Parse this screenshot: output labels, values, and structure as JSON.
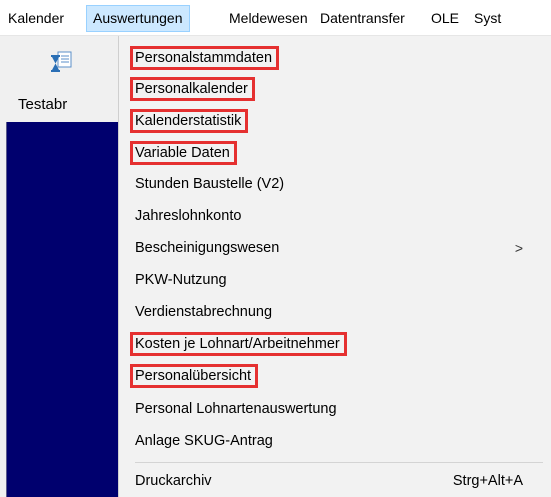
{
  "menubar": {
    "items": [
      {
        "label": "Kalender"
      },
      {
        "label": "Auswertungen"
      },
      {
        "label": "Meldewesen"
      },
      {
        "label": "Datentransfer"
      },
      {
        "label": "OLE"
      },
      {
        "label": "Syst"
      }
    ]
  },
  "toolbar": {
    "button_label": "Testabr",
    "button_icon": "hourglass-document-icon"
  },
  "dropdown": {
    "items": [
      {
        "label": "Personalstammdaten",
        "highlighted": true
      },
      {
        "label": "Personalkalender",
        "highlighted": true
      },
      {
        "label": "Kalenderstatistik",
        "highlighted": true
      },
      {
        "label": "Variable Daten",
        "highlighted": true
      },
      {
        "label": "Stunden Baustelle (V2)",
        "highlighted": false
      },
      {
        "label": "Jahreslohnkonto",
        "highlighted": false
      },
      {
        "label": "Bescheinigungswesen",
        "highlighted": false,
        "submenu_arrow": ">"
      },
      {
        "label": "PKW-Nutzung",
        "highlighted": false
      },
      {
        "label": "Verdienstabrechnung",
        "highlighted": false
      },
      {
        "label": "Kosten je Lohnart/Arbeitnehmer",
        "highlighted": true
      },
      {
        "label": "Personalübersicht",
        "highlighted": true
      },
      {
        "label": "Personal Lohnartenauswertung",
        "highlighted": false
      },
      {
        "label": "Anlage SKUG-Antrag",
        "highlighted": false
      },
      {
        "label": "Druckarchiv",
        "highlighted": false,
        "shortcut": "Strg+Alt+A"
      }
    ]
  },
  "colors": {
    "highlight_border": "#e53030",
    "active_menu_bg": "#cce8ff",
    "dark_panel": "#00006e"
  }
}
